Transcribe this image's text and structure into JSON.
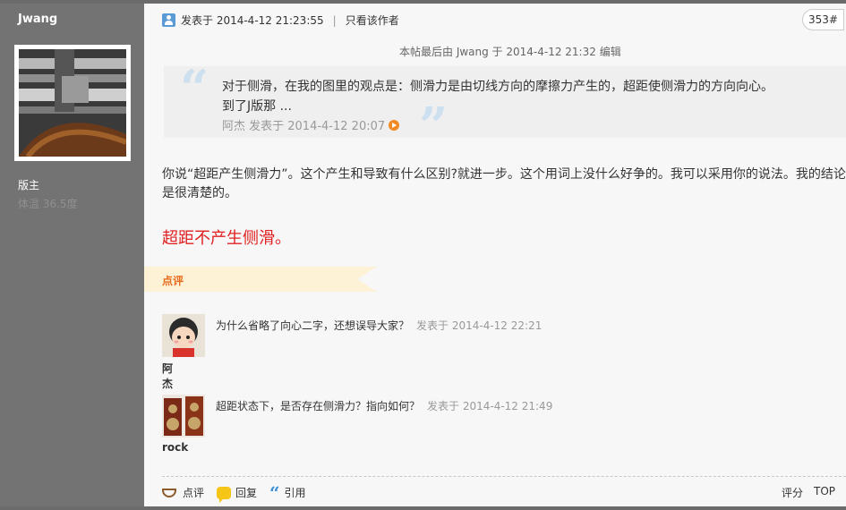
{
  "sidebar": {
    "username": "Jwang",
    "role": "版主",
    "temperature": "体温 36.5度"
  },
  "post": {
    "meta_prefix": "发表于 2014-4-12 21:23:55",
    "separator": "|",
    "only_author": "只看该作者",
    "floor": "353#",
    "edited_note": "本帖最后由 Jwang 于 2014-4-12 21:32 编辑",
    "quote": {
      "line1": "对于侧滑，在我的图里的观点是：侧滑力是由切线方向的摩擦力产生的，超距使侧滑力的方向向心。",
      "line2": "到了J版那 ...",
      "meta": "阿杰 发表于 2014-4-12 20:07"
    },
    "body": "你说“超距产生侧滑力”。这个产生和导致有什么区别?就进一步。这个用词上没什么好争的。我可以采用你的说法。我的结论是很清楚的。",
    "highlight": "超距不产生侧滑。"
  },
  "comments_tab": "点评",
  "comments": [
    {
      "author": "阿杰",
      "text": "为什么省略了向心二字，还想误导大家？",
      "time": "发表于 2014-4-12 22:21"
    },
    {
      "author": "rock",
      "text": "超距状态下，是否存在侧滑力？指向如何？",
      "time": "发表于 2014-4-12 21:49"
    }
  ],
  "actions": {
    "comment": "点评",
    "reply": "回复",
    "quote": "引用",
    "rate": "评分",
    "top": "TOP"
  },
  "colors": {
    "sidebar": "#737373",
    "highlight_red": "#e02020",
    "comment_tab_text": "#e76b1b"
  }
}
